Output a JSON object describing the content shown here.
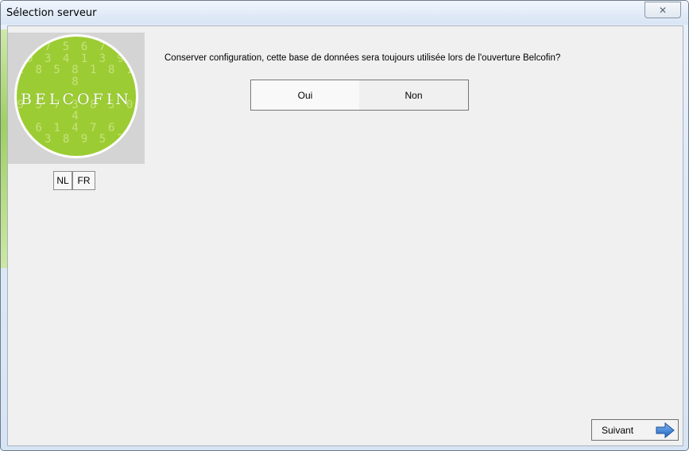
{
  "window": {
    "title": "Sélection serveur",
    "close_glyph": "✕"
  },
  "logo": {
    "brand": "BELCOFIN",
    "digit_rows": [
      "7 5 6 7",
      "9 3 4 1 3 9",
      "2 8 5 8 1 8 1 8",
      "",
      "9 5 7 3 8 5 0 4",
      "8 6 1 4 7 6 4",
      "2 3 8 9 5 7"
    ]
  },
  "language_buttons": {
    "nl": "NL",
    "fr": "FR"
  },
  "dialog": {
    "question": "Conserver configuration, cette base de données sera toujours utilisée lors de l'ouverture Belcofin?",
    "options": [
      "Oui",
      "Non"
    ],
    "selected": "Oui"
  },
  "footer": {
    "next_label": "Suivant"
  },
  "colors": {
    "logo_green": "#9ccc33",
    "arrow_blue": "#2f7fd6",
    "dialog_bg": "#f0f0f0"
  },
  "icons": {
    "close": "close-icon",
    "next": "right-arrow-icon"
  }
}
